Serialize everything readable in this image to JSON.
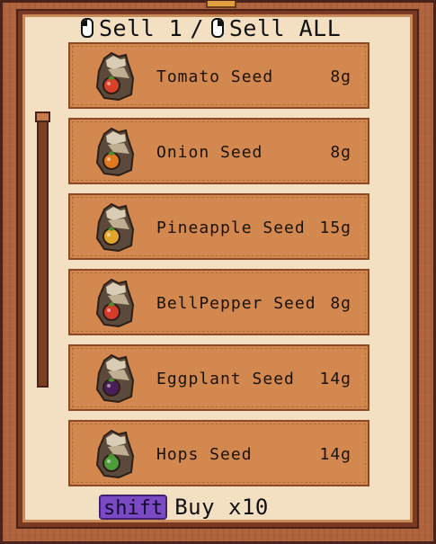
{
  "header": {
    "sell_one_label": "Sell 1",
    "separator": "/",
    "sell_all_label": "Sell ALL",
    "left_icon": "mouse-left-click-icon",
    "right_icon": "mouse-right-click-icon"
  },
  "items": [
    {
      "name": "Tomato Seed",
      "price": "8g",
      "icon": "tomato-seed-bag-icon",
      "color": "#d8402a"
    },
    {
      "name": "Onion Seed",
      "price": "8g",
      "icon": "onion-seed-bag-icon",
      "color": "#e07820"
    },
    {
      "name": "Pineapple Seed",
      "price": "15g",
      "icon": "pineapple-seed-bag-icon",
      "color": "#e3a52a"
    },
    {
      "name": "BellPepper Seed",
      "price": "8g",
      "icon": "bellpepper-seed-bag-icon",
      "color": "#d63a2a"
    },
    {
      "name": "Eggplant Seed",
      "price": "14g",
      "icon": "eggplant-seed-bag-icon",
      "color": "#4a1e5a"
    },
    {
      "name": "Hops Seed",
      "price": "14g",
      "icon": "hops-seed-bag-icon",
      "color": "#4f9a3a"
    }
  ],
  "footer": {
    "modifier_key": "shift",
    "action_label": "Buy x10"
  },
  "scroll": {
    "position": 0
  }
}
